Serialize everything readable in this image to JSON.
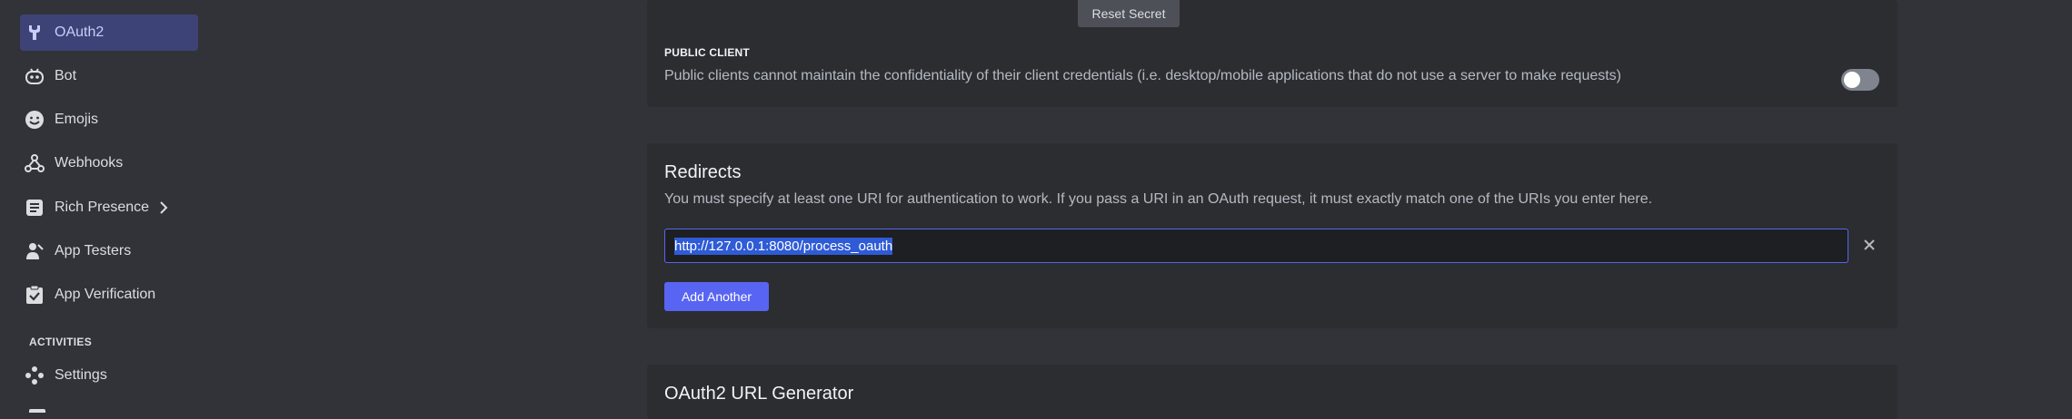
{
  "sidebar": {
    "items": [
      {
        "label": "OAuth2",
        "icon": "wrench-icon",
        "active": true
      },
      {
        "label": "Bot",
        "icon": "bot-icon"
      },
      {
        "label": "Emojis",
        "icon": "emoji-icon"
      },
      {
        "label": "Webhooks",
        "icon": "webhook-icon"
      },
      {
        "label": "Rich Presence",
        "icon": "document-icon",
        "has_chevron": true
      },
      {
        "label": "App Testers",
        "icon": "user-wave-icon"
      },
      {
        "label": "App Verification",
        "icon": "clipboard-check-icon"
      },
      {
        "label": "Settings",
        "icon": "gamepad-icon"
      }
    ],
    "activities_header": "ACTIVITIES"
  },
  "client_secret": {
    "reset_label": "Reset Secret"
  },
  "public_client": {
    "title": "PUBLIC CLIENT",
    "description": "Public clients cannot maintain the confidentiality of their client credentials (i.e. desktop/mobile applications that do not use a server to make requests)",
    "enabled": false
  },
  "redirects": {
    "title": "Redirects",
    "description": "You must specify at least one URI for authentication to work. If you pass a URI in an OAuth request, it must exactly match one of the URIs you enter here.",
    "uris": [
      "http://127.0.0.1:8080/process_oauth"
    ],
    "add_label": "Add Another"
  },
  "url_generator": {
    "title": "OAuth2 URL Generator"
  },
  "colors": {
    "accent": "#5865f2",
    "active_bg": "#3e4377",
    "card_bg": "#2b2d31",
    "page_bg": "#313338"
  }
}
